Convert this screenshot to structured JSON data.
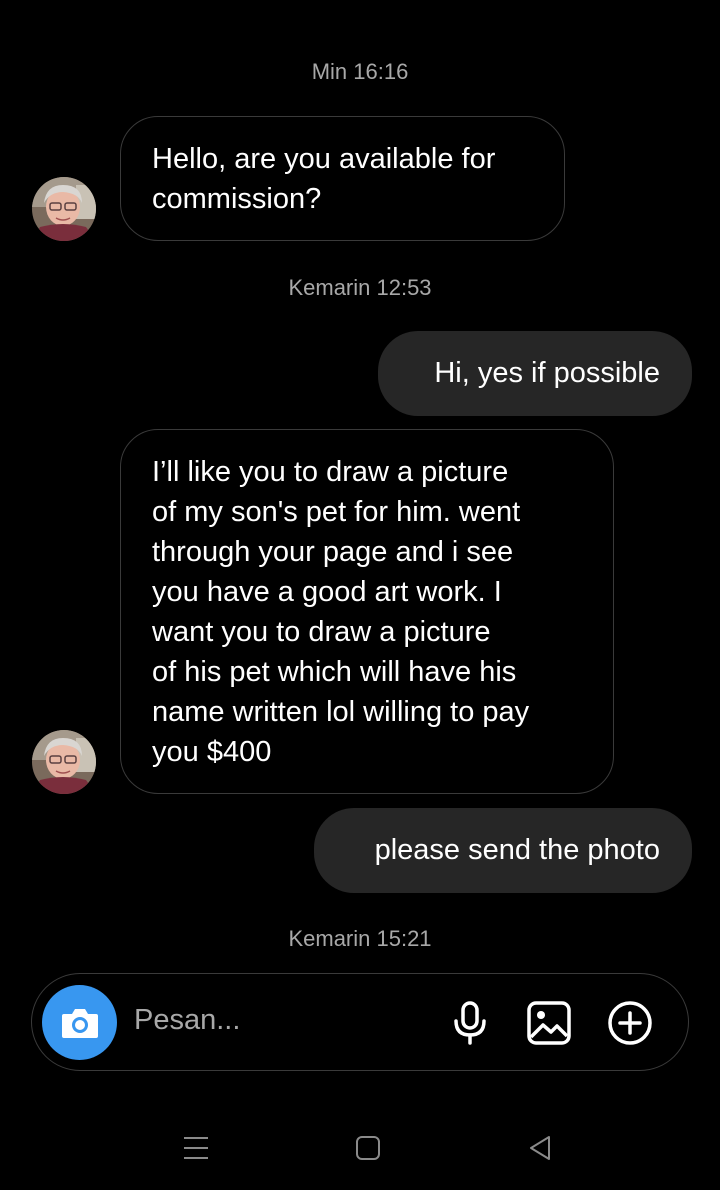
{
  "thread": {
    "timestamps": [
      "Min 16:16",
      "Kemarin 12:53",
      "Kemarin 15:21"
    ],
    "messages": [
      {
        "direction": "incoming",
        "text": "Hello, are you available for\ncommission?"
      },
      {
        "direction": "outgoing",
        "text": "Hi, yes if possible"
      },
      {
        "direction": "incoming",
        "text": "I’ll like you to draw a picture\nof my son's pet for him. went\nthrough your page and i see\nyou have a good art work. I\nwant you to draw a picture\nof his pet which will have his\nname written lol willing to pay\nyou $400"
      },
      {
        "direction": "outgoing",
        "text": "please send the photo"
      }
    ]
  },
  "composer": {
    "placeholder": "Pesan...",
    "icons": [
      "camera-icon",
      "microphone-icon",
      "gallery-icon",
      "add-icon"
    ],
    "accent_color": "#3897f0"
  },
  "navbar": {
    "icons": [
      "recent-apps-icon",
      "home-icon",
      "back-icon"
    ]
  },
  "colors": {
    "background": "#000000",
    "outgoing_bubble": "#262626",
    "incoming_border": "#3a3a3a",
    "timestamp_text": "#a8a8a8"
  }
}
